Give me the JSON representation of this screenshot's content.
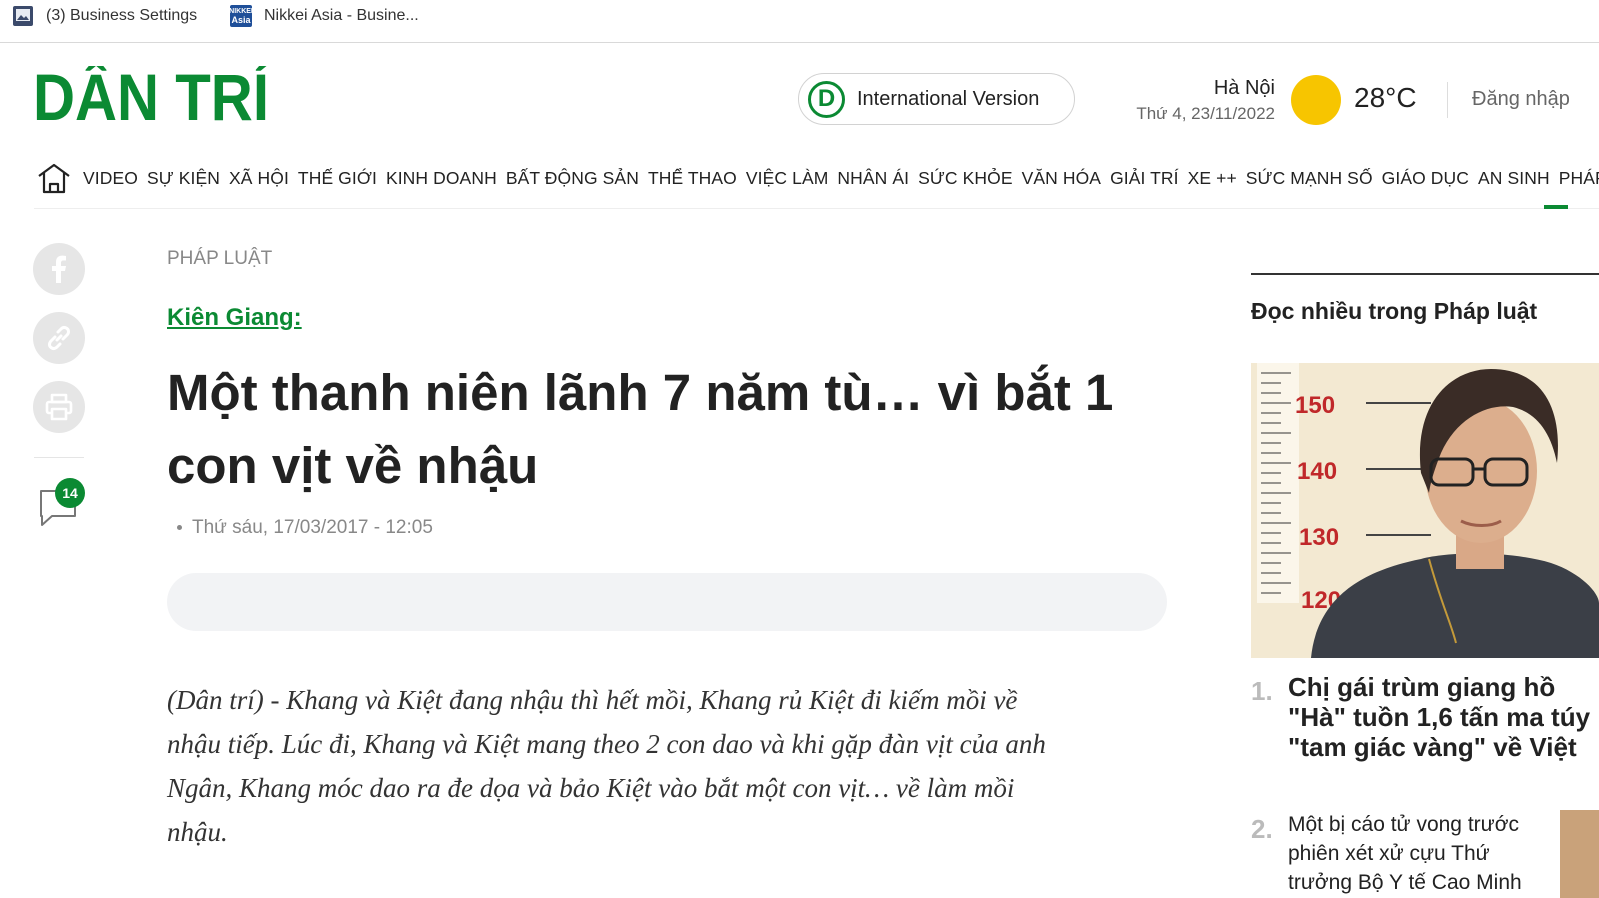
{
  "bookmarks": [
    {
      "label": "(3) Business Settings",
      "icon": "image-icon"
    },
    {
      "label": "Nikkei Asia - Busine...",
      "icon": "nikkei-asia-icon",
      "icon_text_top": "NIKKEI",
      "icon_text_bottom": "Asia"
    }
  ],
  "header": {
    "logo_text": "DÂN TRÍ",
    "intl_icon_letter": "D",
    "intl_label": "International Version",
    "city": "Hà Nội",
    "date": "Thứ 4, 23/11/2022",
    "temperature": "28°C",
    "login": "Đăng nhập"
  },
  "nav": {
    "items": [
      "VIDEO",
      "SỰ KIỆN",
      "XÃ HỘI",
      "THẾ GIỚI",
      "KINH DOANH",
      "BẤT ĐỘNG SẢN",
      "THỂ THAO",
      "VIỆC LÀM",
      "NHÂN ÁI",
      "SỨC KHỎE",
      "VĂN HÓA",
      "GIẢI TRÍ",
      "XE ++",
      "SỨC MẠNH SỐ",
      "GIÁO DỤC",
      "AN SINH",
      "PHÁP LUẬT"
    ]
  },
  "share": {
    "comment_count": "14"
  },
  "article": {
    "category": "PHÁP LUẬT",
    "kicker": "Kiên Giang:",
    "headline_line1": "Một thanh niên lãnh 7 năm tù… vì bắt 1",
    "headline_line2": "con vịt về nhậu",
    "date": "Thứ sáu, 17/03/2017 - 12:05",
    "lead_lines": [
      "(Dân trí) - Khang và Kiệt đang nhậu thì hết mồi, Khang rủ Kiệt đi kiếm mồi về",
      "nhậu tiếp. Lúc đi, Khang và Kiệt mang theo 2 con dao và khi gặp đàn vịt của anh",
      "Ngân, Khang móc dao ra đe dọa và bảo Kiệt vào bắt một con vịt… về làm mồi",
      "nhậu."
    ]
  },
  "sidebar": {
    "title": "Đọc nhiều trong Pháp luật",
    "ruler_marks": [
      "150",
      "140",
      "130",
      "120"
    ],
    "items": [
      {
        "num": "1.",
        "lines": [
          "Chị gái trùm giang hồ",
          "\"Hà\" tuồn 1,6 tấn ma túy",
          "\"tam giác vàng\" về Việt"
        ]
      },
      {
        "num": "2.",
        "lines": [
          "Một bị cáo tử vong trước",
          "phiên xét xử cựu Thứ",
          "trưởng Bộ Y tế Cao Minh"
        ]
      }
    ]
  },
  "colors": {
    "brand_green": "#0b8a33",
    "sun_yellow": "#f7c500"
  }
}
